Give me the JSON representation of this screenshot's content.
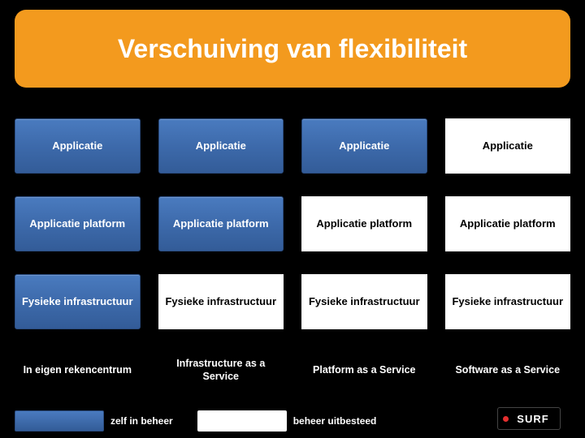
{
  "title": "Verschuiving van flexibiliteit",
  "columns": [
    {
      "layers": [
        {
          "label": "Applicatie",
          "managed": "self"
        },
        {
          "label": "Applicatie platform",
          "managed": "self"
        },
        {
          "label": "Fysieke infrastructuur",
          "managed": "self"
        }
      ],
      "caption": "In eigen rekencentrum"
    },
    {
      "layers": [
        {
          "label": "Applicatie",
          "managed": "self"
        },
        {
          "label": "Applicatie platform",
          "managed": "self"
        },
        {
          "label": "Fysieke infrastructuur",
          "managed": "outsourced"
        }
      ],
      "caption": "Infrastructure as a Service"
    },
    {
      "layers": [
        {
          "label": "Applicatie",
          "managed": "self"
        },
        {
          "label": "Applicatie platform",
          "managed": "outsourced"
        },
        {
          "label": "Fysieke infrastructuur",
          "managed": "outsourced"
        }
      ],
      "caption": "Platform as a Service"
    },
    {
      "layers": [
        {
          "label": "Applicatie",
          "managed": "outsourced"
        },
        {
          "label": "Applicatie platform",
          "managed": "outsourced"
        },
        {
          "label": "Fysieke infrastructuur",
          "managed": "outsourced"
        }
      ],
      "caption": "Software as a Service"
    }
  ],
  "legend": {
    "self": "zelf in beheer",
    "outsourced": "beheer uitbesteed"
  },
  "logo": "SURF"
}
